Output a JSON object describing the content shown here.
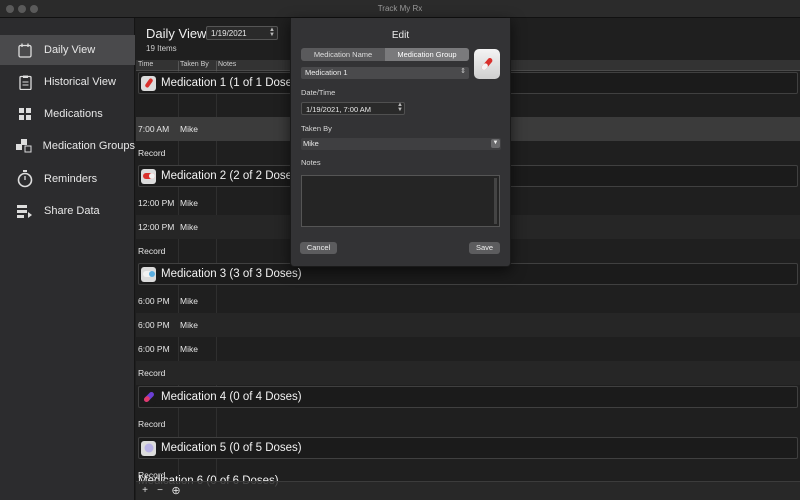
{
  "window": {
    "title": "Track My Rx"
  },
  "sidebar": {
    "items": [
      {
        "label": "Daily View",
        "icon": "calendar-icon",
        "active": true
      },
      {
        "label": "Historical View",
        "icon": "clipboard-icon",
        "active": false
      },
      {
        "label": "Medications",
        "icon": "grid-icon",
        "active": false
      },
      {
        "label": "Medication Groups",
        "icon": "stack-icon",
        "active": false
      },
      {
        "label": "Reminders",
        "icon": "stopwatch-icon",
        "active": false
      },
      {
        "label": "Share Data",
        "icon": "share-icon",
        "active": false
      }
    ]
  },
  "main": {
    "title": "Daily View",
    "date": "1/19/2021",
    "item_count": "19 Items",
    "columns": {
      "time": "Time",
      "taken_by": "Taken By",
      "notes": "Notes"
    },
    "groups": [
      {
        "name": "Medication 1 (1 of 1 Doses)",
        "icon": "pill-red-icon",
        "doses": [
          {
            "time": "7:00 AM",
            "by": "Mike"
          }
        ],
        "record": "Record"
      },
      {
        "name": "Medication 2 (2 of 2 Doses)",
        "icon": "capsule-red-icon",
        "doses": [
          {
            "time": "12:00 PM",
            "by": "Mike"
          },
          {
            "time": "12:00 PM",
            "by": "Mike"
          }
        ],
        "record": "Record"
      },
      {
        "name": "Medication 3 (3 of 3 Doses)",
        "icon": "capsule-blue-icon",
        "doses": [
          {
            "time": "6:00 PM",
            "by": "Mike"
          },
          {
            "time": "6:00 PM",
            "by": "Mike"
          },
          {
            "time": "6:00 PM",
            "by": "Mike"
          }
        ],
        "record": "Record"
      },
      {
        "name": "Medication 4 (0 of 4 Doses)",
        "icon": "capsule-purple-icon",
        "doses": [],
        "record": "Record"
      },
      {
        "name": "Medication 5 (0 of 5 Doses)",
        "icon": "tablet-lavender-icon",
        "doses": [],
        "record": "Record"
      },
      {
        "name": "Medication 6 (0 of 6 Doses)",
        "icon": "",
        "doses": [],
        "record": ""
      }
    ]
  },
  "bottombar": {
    "add": "+",
    "remove": "−",
    "more": "⊕"
  },
  "edit": {
    "title": "Edit",
    "segments": [
      "Medication Name",
      "Medication Group"
    ],
    "selected_segment": 1,
    "medication": "Medication 1",
    "datetime_label": "Date/Time",
    "datetime_value": "1/19/2021,   7:00 AM",
    "taken_by_label": "Taken By",
    "taken_by_value": "Mike",
    "notes_label": "Notes",
    "cancel": "Cancel",
    "save": "Save"
  },
  "colors": {
    "accent_red": "#d9302c",
    "sidebar_bg": "#2c2c2e",
    "selected_bg": "#4a4a4c"
  }
}
